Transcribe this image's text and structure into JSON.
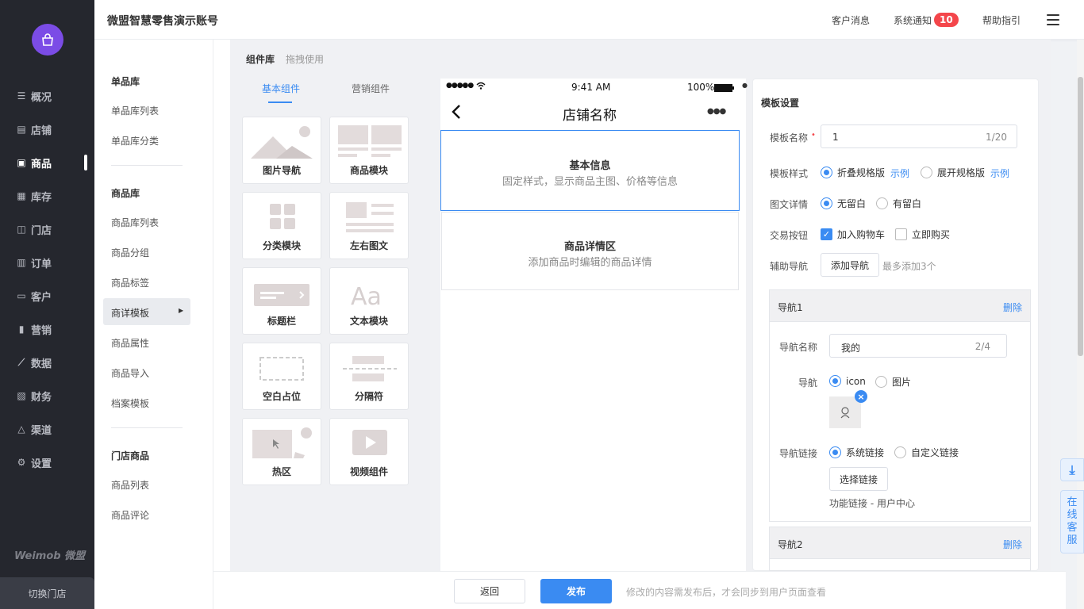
{
  "sidebar": {
    "items": [
      {
        "label": "概况",
        "icon": "overview-icon"
      },
      {
        "label": "店铺",
        "icon": "store-icon"
      },
      {
        "label": "商品",
        "icon": "goods-icon"
      },
      {
        "label": "库存",
        "icon": "inventory-icon"
      },
      {
        "label": "门店",
        "icon": "shop-icon"
      },
      {
        "label": "订单",
        "icon": "order-icon"
      },
      {
        "label": "客户",
        "icon": "customer-icon"
      },
      {
        "label": "营销",
        "icon": "marketing-icon"
      },
      {
        "label": "数据",
        "icon": "data-icon"
      },
      {
        "label": "财务",
        "icon": "finance-icon"
      },
      {
        "label": "渠道",
        "icon": "channel-icon"
      },
      {
        "label": "设置",
        "icon": "settings-icon"
      }
    ],
    "active_index": 2,
    "brand": "Weimob 微盟",
    "switch_store": "切换门店"
  },
  "subnav": {
    "groups": [
      {
        "title": "单品库",
        "items": [
          "单品库列表",
          "单品库分类"
        ]
      },
      {
        "title": "商品库",
        "items": [
          "商品库列表",
          "商品分组",
          "商品标签",
          "商详模板",
          "商品属性",
          "商品导入",
          "档案模板"
        ]
      },
      {
        "title": "门店商品",
        "items": [
          "商品列表",
          "商品评论"
        ]
      }
    ],
    "active": "商详模板"
  },
  "header": {
    "account": "微盟智慧零售演示账号",
    "messages": "客户消息",
    "notify": "系统通知",
    "notify_count": "10",
    "help": "帮助指引"
  },
  "library": {
    "title": "组件库",
    "hint": "拖拽使用",
    "tabs": [
      "基本组件",
      "营销组件"
    ],
    "active_tab": 0,
    "components": [
      "图片导航",
      "商品模块",
      "分类模块",
      "左右图文",
      "标题栏",
      "文本模块",
      "空白占位",
      "分隔符",
      "热区",
      "视频组件"
    ]
  },
  "phone": {
    "signal": "●●●●●",
    "time": "9:41 AM",
    "battery": "100%",
    "title": "店铺名称",
    "more": "●●●",
    "blocks": [
      {
        "title": "基本信息",
        "desc": "固定样式，显示商品主图、价格等信息"
      },
      {
        "title": "商品详情区",
        "desc": "添加商品时编辑的商品详情"
      }
    ]
  },
  "settings": {
    "title": "模板设置",
    "name_label": "模板名称",
    "name_value": "1",
    "name_count": "1/20",
    "style_label": "模板样式",
    "style_opt1": "折叠规格版",
    "style_opt2": "展开规格版",
    "example": "示例",
    "detail_label": "图文详情",
    "detail_opt1": "无留白",
    "detail_opt2": "有留白",
    "trade_label": "交易按钮",
    "trade_opt1": "加入购物车",
    "trade_opt2": "立即购买",
    "aux_label": "辅助导航",
    "add_nav": "添加导航",
    "add_hint": "最多添加3个",
    "nav1": {
      "title": "导航1",
      "delete": "删除",
      "name_label": "导航名称",
      "name_value": "我的",
      "name_count": "2/4",
      "nav_label": "导航",
      "opt_icon": "icon",
      "opt_img": "图片",
      "link_label": "导航链接",
      "link_opt1": "系统链接",
      "link_opt2": "自定义链接",
      "choose_link": "选择链接",
      "link_desc": "功能链接 - 用户中心"
    },
    "nav2": {
      "title": "导航2",
      "delete": "删除"
    }
  },
  "footer": {
    "back": "返回",
    "publish": "发布",
    "hint": "修改的内容需发布后，才会同步到用户页面查看"
  },
  "float": {
    "service": "在线客服"
  },
  "colors": {
    "accent": "#3a8bf2",
    "sidebar_bg": "#25272e",
    "badge": "#f4464b",
    "logo": "#7b4ce6"
  }
}
